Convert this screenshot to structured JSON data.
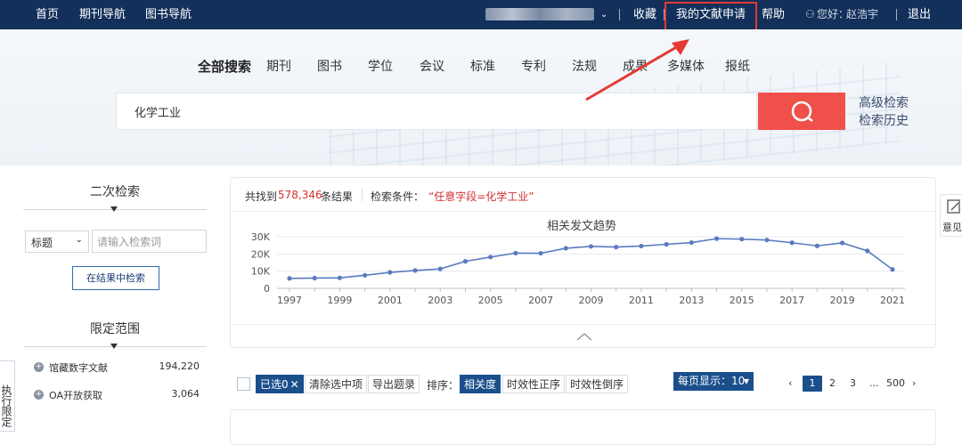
{
  "topnav": {
    "home": "首页",
    "journals": "期刊导航",
    "books": "图书导航",
    "favorites": "收藏",
    "my_requests": "我的文献申请",
    "help": "帮助",
    "greeting": "您好：",
    "username": "赵浩宇",
    "logout": "退出"
  },
  "search_tabs": [
    "全部搜索",
    "期刊",
    "图书",
    "学位",
    "会议",
    "标准",
    "专利",
    "法规",
    "成果",
    "多媒体",
    "报纸"
  ],
  "search": {
    "query": "化学工业"
  },
  "side_links": {
    "advanced": "高级检索",
    "history": "检索历史"
  },
  "left_panel": {
    "secondary_title": "二次检索",
    "field_value": "标题",
    "input_placeholder": "请输入检索词",
    "refine_button": "在结果中检索",
    "scope_title": "限定范围",
    "scope_items": [
      {
        "label": "馆藏数字文献",
        "count": "194,220"
      },
      {
        "label": "OA开放获取",
        "count": "3,064"
      }
    ],
    "side_tab": "执行限定"
  },
  "results": {
    "found_prefix": "共找到",
    "found_count": "578,346",
    "found_suffix": "条结果",
    "cond_label": "检索条件：",
    "cond_value": "“任意字段=化学工业”"
  },
  "feedback": "意见",
  "chart_data": {
    "type": "line",
    "title": "相关发文趋势",
    "x": [
      1997,
      1998,
      1999,
      2000,
      2001,
      2002,
      2003,
      2004,
      2005,
      2006,
      2007,
      2008,
      2009,
      2010,
      2011,
      2012,
      2013,
      2014,
      2015,
      2016,
      2017,
      2018,
      2019,
      2020,
      2021
    ],
    "values": [
      5800,
      6000,
      6100,
      7600,
      9300,
      10400,
      11300,
      15700,
      18200,
      20500,
      20400,
      23300,
      24400,
      24000,
      24600,
      25600,
      26600,
      28900,
      28600,
      28100,
      26500,
      24700,
      26400,
      21800,
      11000
    ],
    "x_ticks": [
      "1997",
      "1999",
      "2001",
      "2003",
      "2005",
      "2007",
      "2009",
      "2011",
      "2013",
      "2015",
      "2017",
      "2019",
      "2021"
    ],
    "y_ticks": [
      "0",
      "10K",
      "20K",
      "30K"
    ],
    "ylim": [
      0,
      30000
    ],
    "grid": true,
    "color": "#5b7bc0"
  },
  "toolbar": {
    "selected": "已选0",
    "clear": "清除选中项",
    "export": "导出题录",
    "sort_label": "排序：",
    "sort_relevance": "相关度",
    "sort_asc": "时效性正序",
    "sort_desc": "时效性倒序",
    "per_page": "每页显示：10"
  },
  "pager": {
    "pages": [
      "1",
      "2",
      "3"
    ],
    "ellipsis": "...",
    "last": "500"
  },
  "colors": {
    "nav_bg": "#12305a",
    "search_btn": "#f0504a",
    "accent": "#1a4f8c",
    "highlight": "#e53935",
    "count_red": "#d32f2f"
  }
}
